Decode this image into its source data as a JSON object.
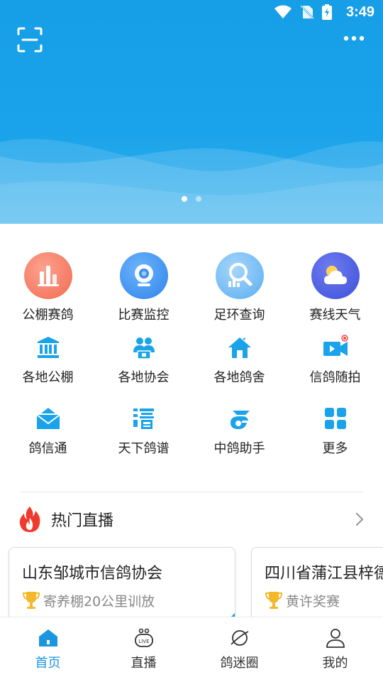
{
  "status_bar": {
    "time": "3:49"
  },
  "banner": {
    "dots": 2,
    "active_dot": 0
  },
  "grid": [
    [
      {
        "label": "公棚赛鸽",
        "icon": "bar-chart-icon",
        "color": "#f4735a"
      },
      {
        "label": "比赛监控",
        "icon": "webcam-icon",
        "color": "#3a8ef0"
      },
      {
        "label": "足环查询",
        "icon": "magnifier-chart-icon",
        "color": "#6ab6f2"
      },
      {
        "label": "赛线天气",
        "icon": "cloud-sun-icon",
        "color": "#4a5de0"
      }
    ],
    [
      {
        "label": "各地公棚",
        "icon": "building-icon",
        "color": "#1aa3ea"
      },
      {
        "label": "各地协会",
        "icon": "association-icon",
        "color": "#1aa3ea"
      },
      {
        "label": "各地鸽舍",
        "icon": "house-icon",
        "color": "#1aa3ea"
      },
      {
        "label": "信鸽随拍",
        "icon": "video-camera-icon",
        "color": "#1aa3ea"
      }
    ],
    [
      {
        "label": "鸽信通",
        "icon": "envelope-icon",
        "color": "#1aa3ea"
      },
      {
        "label": "天下鸽谱",
        "icon": "pedigree-icon",
        "color": "#1aa3ea"
      },
      {
        "label": "中鸽助手",
        "icon": "assistant-logo-icon",
        "color": "#1aa3ea"
      },
      {
        "label": "更多",
        "icon": "grid-more-icon",
        "color": "#1aa3ea"
      }
    ]
  ],
  "live": {
    "title": "热门直播",
    "cards": [
      {
        "title": "山东邹城市信鸽协会",
        "subtitle": "寄养棚20公里训放"
      },
      {
        "title": "四川省蒲江县梓德",
        "subtitle": "黄许奖赛"
      }
    ]
  },
  "tabs": [
    {
      "label": "首页",
      "icon": "home-icon",
      "active": true
    },
    {
      "label": "直播",
      "icon": "live-icon",
      "active": false
    },
    {
      "label": "鸽迷圈",
      "icon": "planet-icon",
      "active": false
    },
    {
      "label": "我的",
      "icon": "user-icon",
      "active": false
    }
  ],
  "colors": {
    "accent": "#1aa3ea",
    "active_tab": "#1a96e0"
  }
}
